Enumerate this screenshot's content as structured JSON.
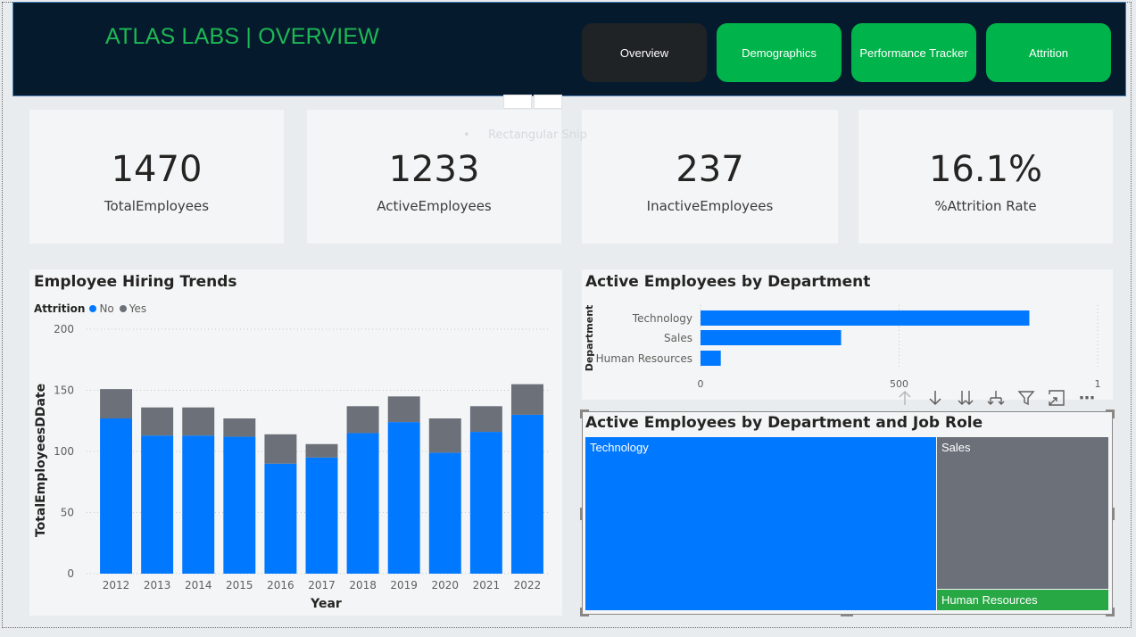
{
  "header": {
    "title": "ATLAS LABS | OVERVIEW",
    "nav": [
      {
        "label": "Overview",
        "active": true
      },
      {
        "label": "Demographics",
        "active": false
      },
      {
        "label": "Performance Tracker",
        "active": false
      },
      {
        "label": "Attrition",
        "active": false
      }
    ],
    "colors": {
      "background": "#061a2e",
      "title": "#1db954",
      "active_button": "#1f2326",
      "button": "#00b34a"
    }
  },
  "ghost_label": "Rectangular Snip",
  "kpis": [
    {
      "value": "1470",
      "label": "TotalEmployees"
    },
    {
      "value": "1233",
      "label": "ActiveEmployees"
    },
    {
      "value": "237",
      "label": "InactiveEmployees"
    },
    {
      "value": "16.1%",
      "label": "%Attrition Rate"
    }
  ],
  "hiring_chart": {
    "title": "Employee Hiring Trends",
    "legend_title": "Attrition",
    "chart_data": {
      "type": "bar",
      "stacked": true,
      "categories": [
        "2012",
        "2013",
        "2014",
        "2015",
        "2016",
        "2017",
        "2018",
        "2019",
        "2020",
        "2021",
        "2022"
      ],
      "series": [
        {
          "name": "No",
          "color": "#0078ff",
          "values": [
            127,
            113,
            113,
            112,
            90,
            95,
            115,
            124,
            99,
            116,
            130
          ]
        },
        {
          "name": "Yes",
          "color": "#6b7079",
          "values": [
            24,
            23,
            23,
            15,
            24,
            11,
            22,
            21,
            28,
            21,
            25
          ]
        }
      ],
      "xlabel": "Year",
      "ylabel": "TotalEmployeesDDate",
      "ylim": [
        0,
        200
      ],
      "yticks": [
        0,
        50,
        100,
        150,
        200
      ],
      "grid": true,
      "legend_position": "top-left"
    }
  },
  "dept_chart": {
    "title": "Active Employees by Department",
    "chart_data": {
      "type": "bar",
      "orientation": "horizontal",
      "categories": [
        "Technology",
        "Sales",
        "Human Resources"
      ],
      "values": [
        828,
        354,
        51
      ],
      "ylabel": "Department",
      "xlim": [
        0,
        1000
      ],
      "xticks": [
        "0",
        "500",
        "1"
      ],
      "color": "#0078ff"
    }
  },
  "treemap": {
    "title": "Active Employees by Department and Job Role",
    "chart_data": {
      "type": "treemap",
      "items": [
        {
          "label": "Technology",
          "value": 828,
          "color": "#0078ff"
        },
        {
          "label": "Sales",
          "value": 354,
          "color": "#6b7079"
        },
        {
          "label": "Human Resources",
          "value": 51,
          "color": "#28a745"
        }
      ]
    }
  },
  "toolbar_icons": [
    "arrow-up-icon",
    "arrow-down-icon",
    "double-arrow-down-icon",
    "expand-hierarchy-icon",
    "filter-icon",
    "focus-mode-icon",
    "more-options-icon"
  ]
}
